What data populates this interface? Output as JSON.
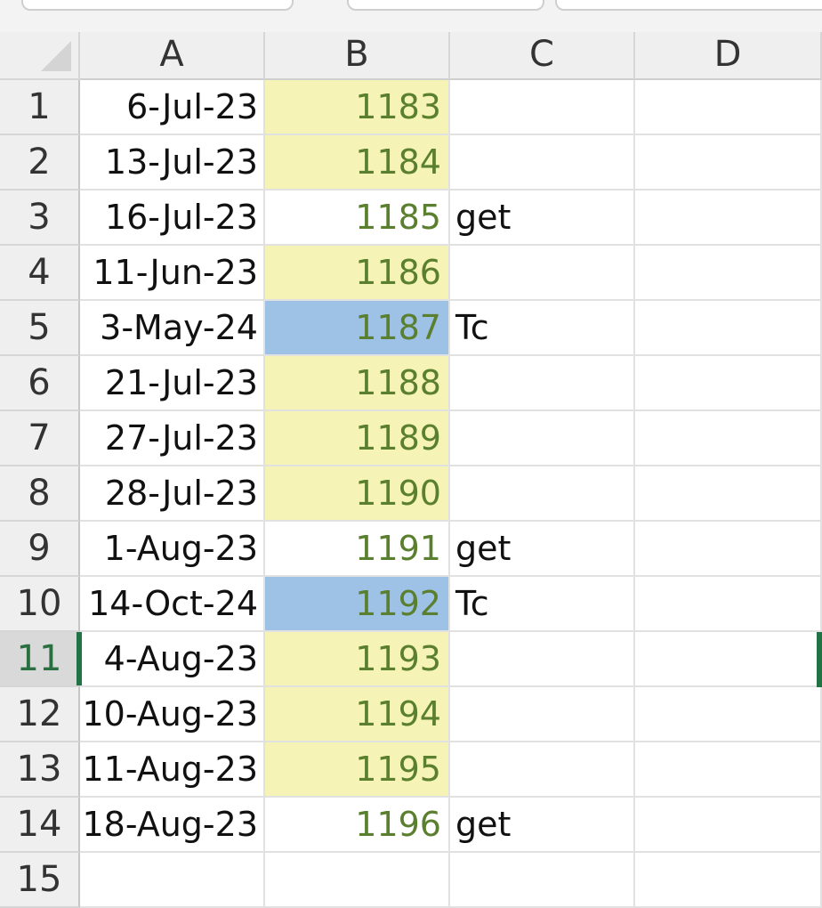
{
  "columns": [
    "A",
    "B",
    "C",
    "D"
  ],
  "rows": [
    {
      "num": "1",
      "a": "6-Jul-23",
      "b": "1183",
      "c": "",
      "fill": "yellow"
    },
    {
      "num": "2",
      "a": "13-Jul-23",
      "b": "1184",
      "c": "",
      "fill": "yellow"
    },
    {
      "num": "3",
      "a": "16-Jul-23",
      "b": "1185",
      "c": "get",
      "fill": "none"
    },
    {
      "num": "4",
      "a": "11-Jun-23",
      "b": "1186",
      "c": "",
      "fill": "yellow"
    },
    {
      "num": "5",
      "a": "3-May-24",
      "b": "1187",
      "c": "Tc",
      "fill": "blue"
    },
    {
      "num": "6",
      "a": "21-Jul-23",
      "b": "1188",
      "c": "",
      "fill": "yellow"
    },
    {
      "num": "7",
      "a": "27-Jul-23",
      "b": "1189",
      "c": "",
      "fill": "yellow"
    },
    {
      "num": "8",
      "a": "28-Jul-23",
      "b": "1190",
      "c": "",
      "fill": "yellow"
    },
    {
      "num": "9",
      "a": "1-Aug-23",
      "b": "1191",
      "c": "get",
      "fill": "none"
    },
    {
      "num": "10",
      "a": "14-Oct-24",
      "b": "1192",
      "c": "Tc",
      "fill": "blue"
    },
    {
      "num": "11",
      "a": "4-Aug-23",
      "b": "1193",
      "c": "",
      "fill": "yellow"
    },
    {
      "num": "12",
      "a": "10-Aug-23",
      "b": "1194",
      "c": "",
      "fill": "yellow"
    },
    {
      "num": "13",
      "a": "11-Aug-23",
      "b": "1195",
      "c": "",
      "fill": "yellow"
    },
    {
      "num": "14",
      "a": "18-Aug-23",
      "b": "1196",
      "c": "get",
      "fill": "none"
    },
    {
      "num": "15",
      "a": "",
      "b": "",
      "c": "",
      "fill": "none"
    }
  ],
  "selected_row": "11",
  "colors": {
    "yellow_fill": "#f5f3b5",
    "blue_fill": "#9ec1e6",
    "number_text": "#5a7f2e",
    "selection_accent": "#217346"
  }
}
